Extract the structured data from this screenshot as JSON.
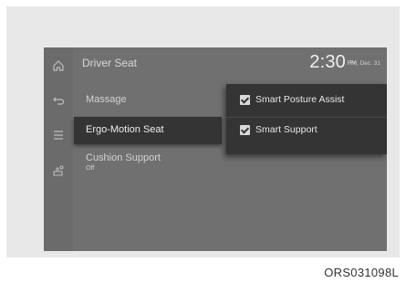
{
  "header": {
    "title": "Driver Seat",
    "time": "2:30",
    "ampm": "PM",
    "date": "Fri, Dec. 31"
  },
  "rail": {
    "icons": [
      "home-icon",
      "back-icon",
      "menu-icon",
      "settings-hand-icon"
    ]
  },
  "menu": {
    "items": [
      {
        "label": "Massage"
      },
      {
        "label": "Ergo-Motion Seat"
      },
      {
        "label": "Cushion Support",
        "sub": "Off"
      }
    ]
  },
  "popup": {
    "options": [
      {
        "label": "Smart Posture Assist",
        "checked": true
      },
      {
        "label": "Smart Support",
        "checked": true
      }
    ]
  },
  "figure_code": "ORS031098L"
}
